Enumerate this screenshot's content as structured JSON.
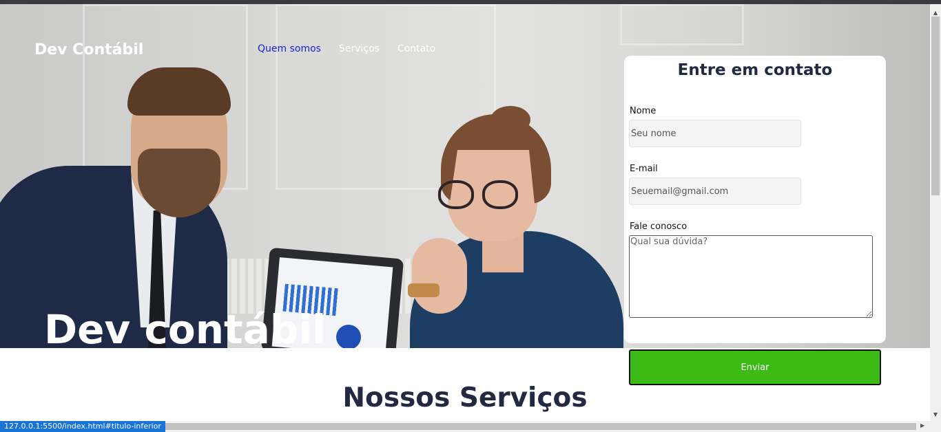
{
  "header": {
    "logo": "Dev Contábil",
    "nav": [
      {
        "label": "Quem somos"
      },
      {
        "label": "Serviços"
      },
      {
        "label": "Contato"
      }
    ]
  },
  "hero": {
    "title": "Dev contábil"
  },
  "contact_form": {
    "title": "Entre em contato",
    "name_label": "Nome",
    "name_placeholder": "Seu nome",
    "email_label": "E-mail",
    "email_placeholder": "Seuemail@gmail.com",
    "message_label": "Fale conosco",
    "message_placeholder": "Qual sua dúvida?",
    "submit_label": "Enviar"
  },
  "services": {
    "title": "Nossos Serviços"
  },
  "status_bar": {
    "url": "127.0.0.1:5500/index.html#titulo-inferior"
  },
  "colors": {
    "accent_green": "#3cbb16",
    "heading_navy": "#232843",
    "active_link": "#1a22d6"
  }
}
